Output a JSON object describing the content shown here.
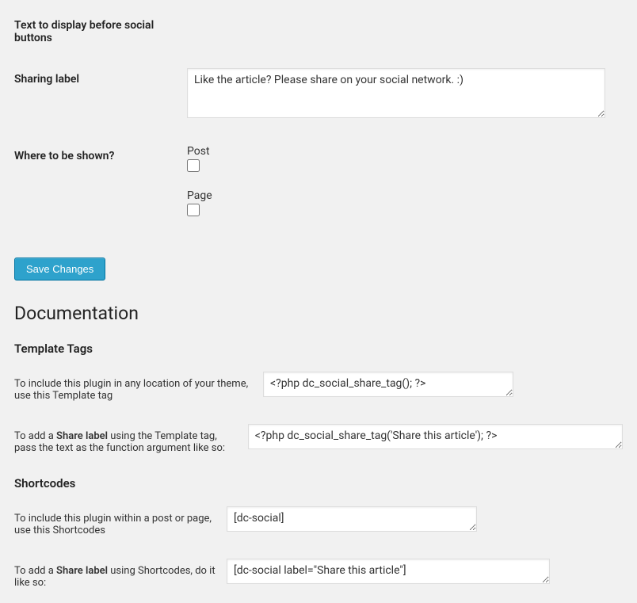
{
  "settings": {
    "text_before_label": "Text to display before social buttons",
    "sharing_label": "Sharing label",
    "sharing_value": "Like the article? Please share on your social network. :)",
    "where_shown_label": "Where to be shown?",
    "post_label": "Post",
    "page_label": "Page",
    "save_button": "Save Changes"
  },
  "documentation": {
    "title": "Documentation",
    "template_tags": {
      "title": "Template Tags",
      "desc1_prefix": "To include this plugin in any location of your theme, use this Template tag",
      "code1": "<?php dc_social_share_tag(); ?>",
      "desc2_prefix": "To add a ",
      "desc2_bold": "Share label",
      "desc2_suffix": " using the Template tag, pass the text as the function argument like so:",
      "code2": "<?php dc_social_share_tag('Share this article'); ?>"
    },
    "shortcodes": {
      "title": "Shortcodes",
      "desc1": "To include this plugin within a post or page, use this Shortcodes",
      "code1": "[dc-social]",
      "desc2_prefix": "To add a ",
      "desc2_bold": "Share label",
      "desc2_suffix": " using Shortcodes, do it like so:",
      "code2": "[dc-social label=\"Share this article\"]"
    }
  }
}
